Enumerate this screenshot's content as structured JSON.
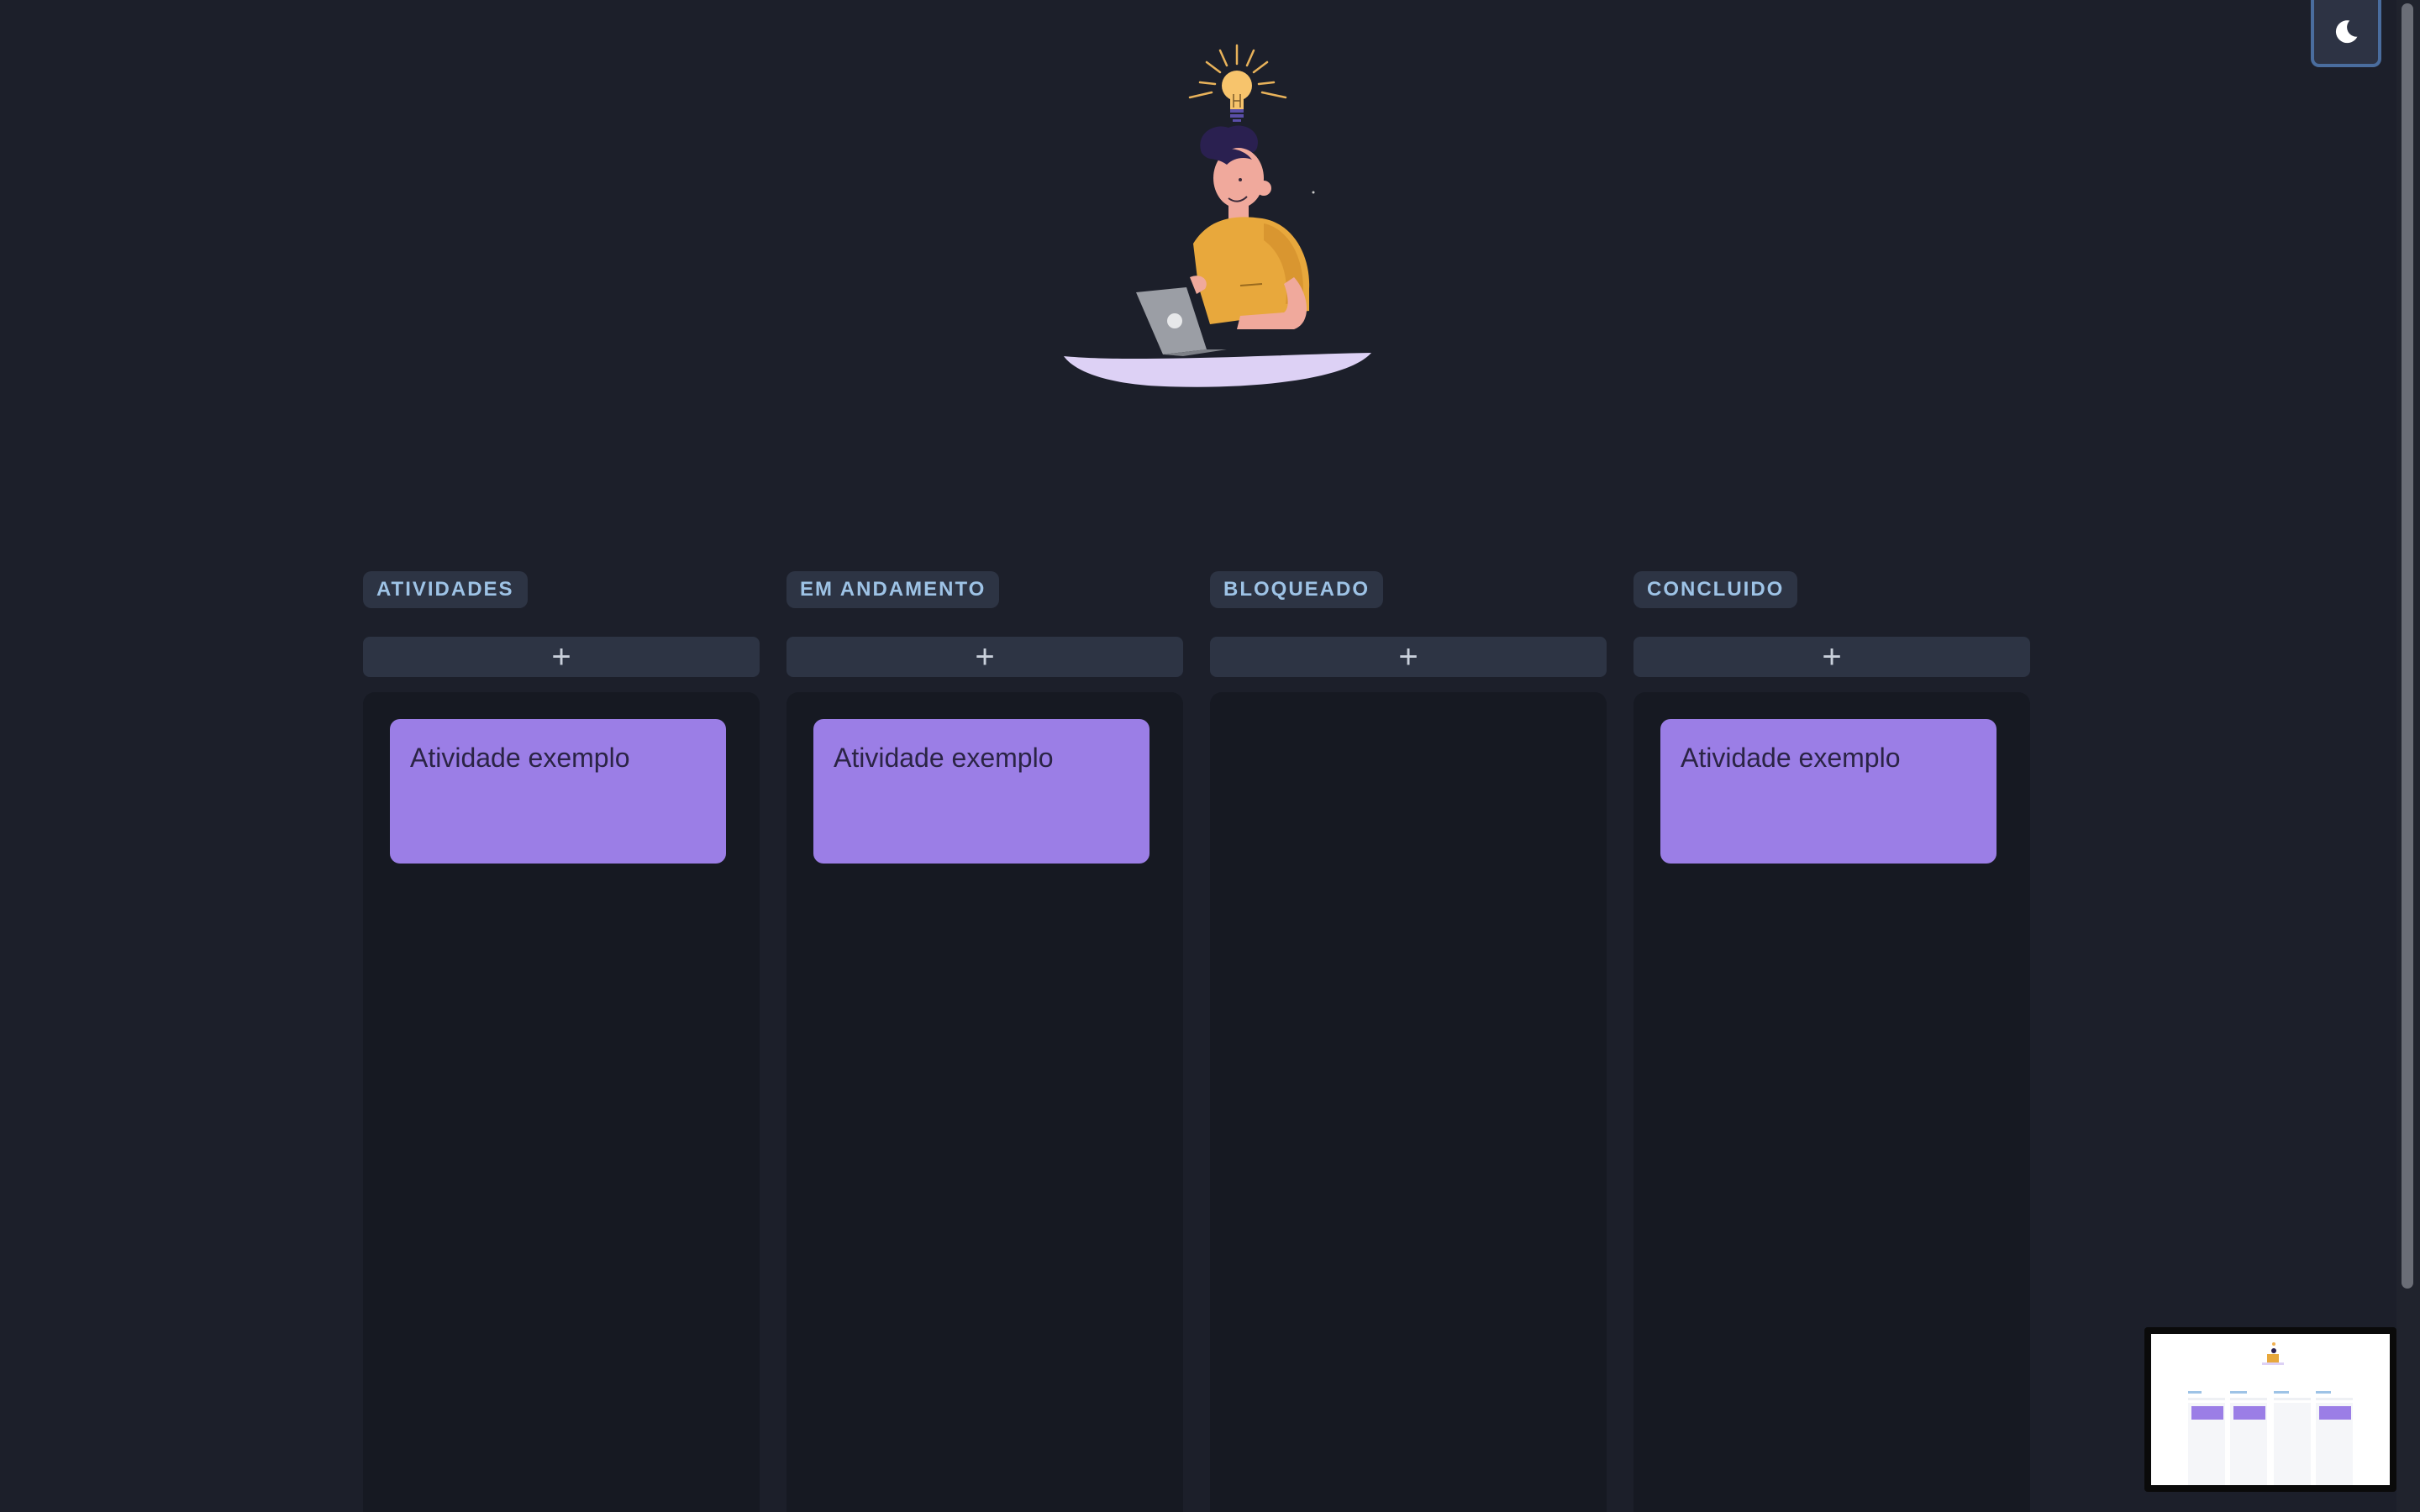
{
  "theme_toggle": {
    "icon": "moon-icon",
    "mode": "dark"
  },
  "columns": [
    {
      "title": "ATIVIDADES",
      "add_label": "+",
      "cards": [
        "Atividade exemplo"
      ]
    },
    {
      "title": "EM ANDAMENTO",
      "add_label": "+",
      "cards": [
        "Atividade exemplo"
      ]
    },
    {
      "title": "BLOQUEADO",
      "add_label": "+",
      "cards": []
    },
    {
      "title": "CONCLUIDO",
      "add_label": "+",
      "cards": [
        "Atividade exemplo"
      ]
    }
  ],
  "colors": {
    "background": "#1c1f2a",
    "column_body": "#161922",
    "tag_bg": "#2d3444",
    "tag_text": "#9ec3e6",
    "card": "#9b7ee6",
    "card_text": "#2b2445"
  }
}
